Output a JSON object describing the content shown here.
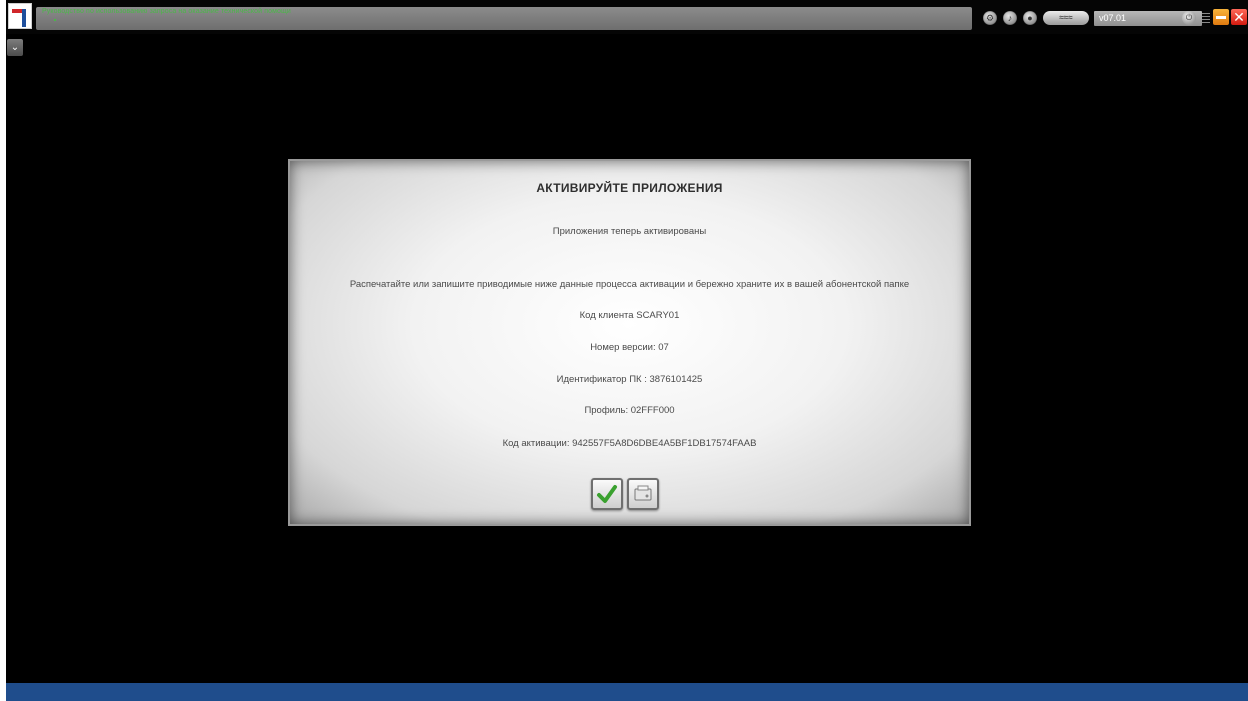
{
  "topbar": {
    "title": "Руководство по использованию запроса на оказание технической помощи",
    "pill_label": "≈≈≈",
    "version": "v07.01"
  },
  "icons": {
    "logo": "logo-icon",
    "round_buttons": [
      "settings-icon",
      "headset-icon",
      "record-icon"
    ],
    "knob": "power-icon",
    "minimize": "minimize-icon",
    "close": "close-icon",
    "dropdown": "chevron-down-icon",
    "ok": "checkmark-icon",
    "print": "print-icon"
  },
  "colors": {
    "title_text": "#49b847",
    "bottom_bar": "#1f4d8c",
    "checkmark": "#3aa12f",
    "close": "#d31b10",
    "minimize": "#e07a10"
  },
  "dialog": {
    "title": "АКТИВИРУЙТЕ ПРИЛОЖЕНИЯ",
    "status": "Приложения теперь активированы",
    "instruction": "Распечатайте или запишите приводимые ниже данные процесса активации и бережно храните их в вашей абонентской папке",
    "client_code": "Код клиента SCARY01",
    "version_number": "Номер версии: 07",
    "pc_id": "Идентификатор ПК : 3876101425",
    "profile": "Профиль: 02FFF000",
    "activation_code": "Код активации: 942557F5A8D6DBE4A5BF1DB17574FAAB"
  }
}
